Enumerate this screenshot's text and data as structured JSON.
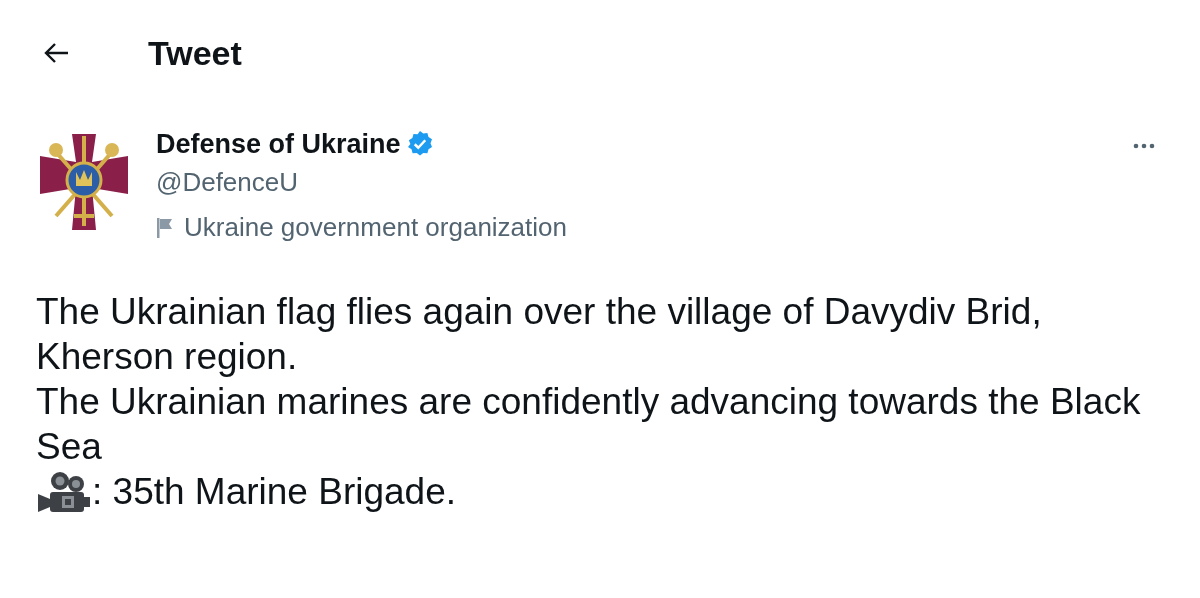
{
  "header": {
    "title": "Tweet"
  },
  "author": {
    "name": "Defense of Ukraine",
    "verified": true,
    "handle": "@DefenceU",
    "label": "Ukraine government organization"
  },
  "body": {
    "text": "The Ukrainian flag flies again over the village of Davydiv Brid, Kherson region.\nThe Ukrainian marines are confidently advancing towards the Black Sea",
    "credit": ": 35th Marine Brigade."
  }
}
